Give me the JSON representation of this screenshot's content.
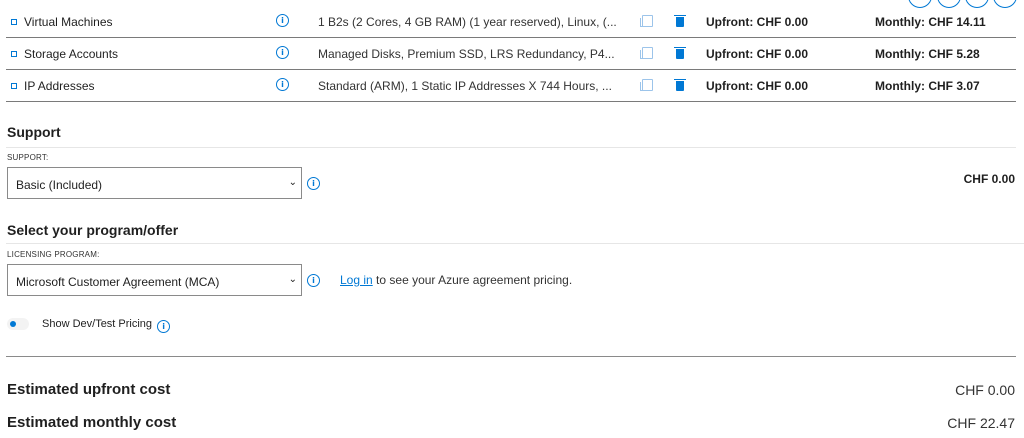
{
  "colors": {
    "accent": "#0078d4",
    "text": "#1f1f1f",
    "divider": "#7a7a7a"
  },
  "estimate_rows": [
    {
      "service": "Virtual Machines",
      "description": "1 B2s (2 Cores, 4 GB RAM) (1 year reserved), Linux, (...",
      "upfront": "Upfront: CHF 0.00",
      "monthly": "Monthly: CHF 14.11"
    },
    {
      "service": "Storage Accounts",
      "description": "Managed Disks, Premium SSD, LRS Redundancy, P4...",
      "upfront": "Upfront: CHF 0.00",
      "monthly": "Monthly: CHF 5.28"
    },
    {
      "service": "IP Addresses",
      "description": "Standard (ARM), 1 Static IP Addresses X 744 Hours, ...",
      "upfront": "Upfront: CHF 0.00",
      "monthly": "Monthly: CHF 3.07"
    }
  ],
  "support": {
    "title": "Support",
    "label": "SUPPORT:",
    "selected": "Basic (Included)",
    "price": "CHF 0.00"
  },
  "program": {
    "title": "Select your program/offer",
    "label": "LICENSING PROGRAM:",
    "selected": "Microsoft Customer Agreement (MCA)",
    "login_link": "Log in",
    "login_text": "to see your Azure agreement pricing."
  },
  "devtest": {
    "label": "Show Dev/Test Pricing"
  },
  "estimates": {
    "upfront_label": "Estimated upfront cost",
    "upfront_value": "CHF 0.00",
    "monthly_label": "Estimated monthly cost",
    "monthly_value": "CHF 22.47"
  },
  "icons": {
    "info": "info-icon",
    "copy": "copy-icon",
    "delete": "trash-icon",
    "dropdown": "chevron-down-icon",
    "expand": "expand-icon"
  }
}
